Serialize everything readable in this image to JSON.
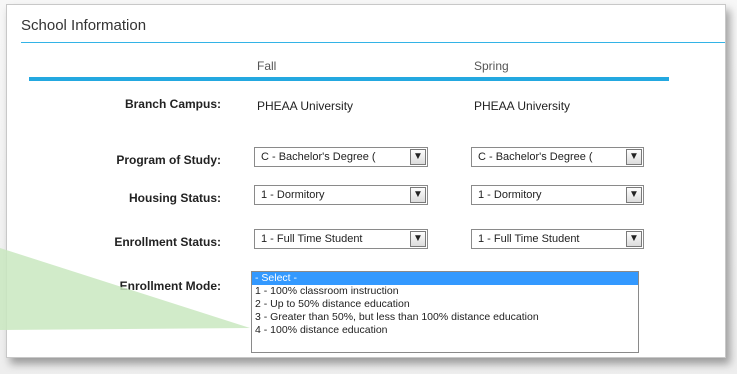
{
  "section_title": "School Information",
  "columns": {
    "fall": "Fall",
    "spring": "Spring"
  },
  "rows": {
    "branch_campus": {
      "label": "Branch Campus:",
      "fall": "PHEAA University",
      "spring": "PHEAA University"
    },
    "program": {
      "label": "Program of Study:",
      "fall": "C - Bachelor's Degree (",
      "spring": "C - Bachelor's Degree ("
    },
    "housing": {
      "label": "Housing Status:",
      "fall": "1 - Dormitory",
      "spring": "1 - Dormitory"
    },
    "enrollment_status": {
      "label": "Enrollment Status:",
      "fall": "1 - Full Time Student",
      "spring": "1 - Full Time Student"
    },
    "enrollment_mode": {
      "label": "Enrollment Mode:",
      "options": [
        "- Select -",
        "1 - 100% classroom instruction",
        "2 - Up to 50% distance education",
        "3 - Greater than 50%, but less than 100% distance education",
        "4 - 100% distance education"
      ],
      "selected_index": 0
    }
  },
  "colors": {
    "accent": "#23a8e0",
    "highlight": "#3399ff",
    "pointer": "#c9e8c0"
  },
  "icons": {
    "dropdown": "chevron-down-icon"
  }
}
